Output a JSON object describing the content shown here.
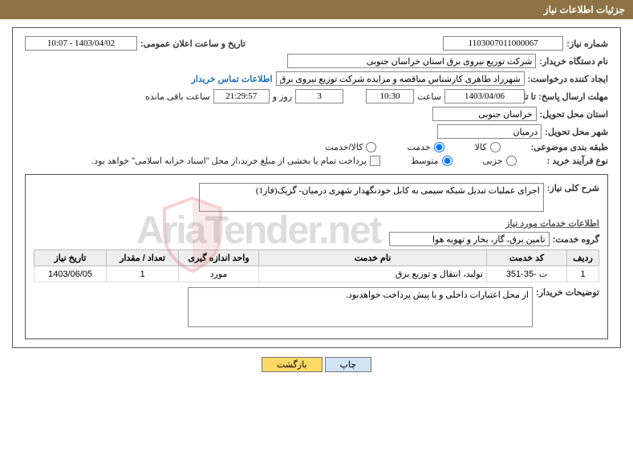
{
  "page_title": "جزئیات اطلاعات نیاز",
  "need_number": {
    "label": "شماره نیاز:",
    "value": "1103007011000067"
  },
  "announce_datetime": {
    "label": "تاریخ و ساعت اعلان عمومی:",
    "value": "1403/04/02 - 10:07"
  },
  "buyer_org": {
    "label": "نام دستگاه خریدار:",
    "value": "شرکت توزیع نیروی برق استان خراسان جنوبی"
  },
  "request_creator": {
    "label": "ایجاد کننده درخواست:",
    "value": "شهرزاد طاهری کارشناس مناقصه و مزایده شرکت توزیع نیروی برق استان خراسا"
  },
  "buyer_contact_link": "اطلاعات تماس خریدار",
  "deadline": {
    "label": "مهلت ارسال پاسخ: تا تاریخ:",
    "date": "1403/04/06",
    "time_label": "ساعت",
    "time": "10:30",
    "days": "3",
    "days_label": "روز و",
    "remain_time": "21:29:57",
    "remain_label": "ساعت باقی مانده"
  },
  "delivery_province": {
    "label": "استان محل تحویل:",
    "value": "خراسان جنوبی"
  },
  "delivery_city": {
    "label": "شهر محل تحویل:",
    "value": "درمیان"
  },
  "subject_class": {
    "label": "طبقه بندی موضوعی:",
    "options": {
      "kala": "کالا",
      "khedmat": "خدمت",
      "kala_khedmat": "کالا/خدمت"
    },
    "selected": "khedmat"
  },
  "purchase_type": {
    "label": "نوع فرآیند خرید :",
    "options": {
      "minor": "جزیی",
      "medium": "متوسط"
    },
    "selected": "medium",
    "payment_note": "پرداخت تمام یا بخشی از مبلغ خرید،از محل \"اسناد خزانه اسلامی\" خواهد بود."
  },
  "need_desc": {
    "label": "شرح کلی نیاز:",
    "value": "اجرای عملیات تبدیل شبکه سیمی به کابل خودنگهدار شهری درمیان- گزیک(فاز1)"
  },
  "services_heading": "اطلاعات خدمات مورد نیاز",
  "service_group": {
    "label": "گروه خدمت:",
    "value": "تامین برق، گاز، بخار و تهویه هوا"
  },
  "table": {
    "headers": {
      "row": "ردیف",
      "code": "کد خدمت",
      "name": "نام خدمت",
      "unit": "واحد اندازه گیری",
      "qty": "تعداد / مقدار",
      "date": "تاریخ نیاز"
    },
    "rows": [
      {
        "row": "1",
        "code": "ت -35-351",
        "name": "تولید، انتقال و توزیع برق",
        "unit": "مورد",
        "qty": "1",
        "date": "1403/06/05"
      }
    ]
  },
  "buyer_notes": {
    "label": "توضیحات خریدار:",
    "value": "از محل اعتبارات داخلی و با پیش پرداخت خواهدبود."
  },
  "buttons": {
    "print": "چاپ",
    "back": "بازگشت"
  },
  "watermark": "AriaTender.net"
}
